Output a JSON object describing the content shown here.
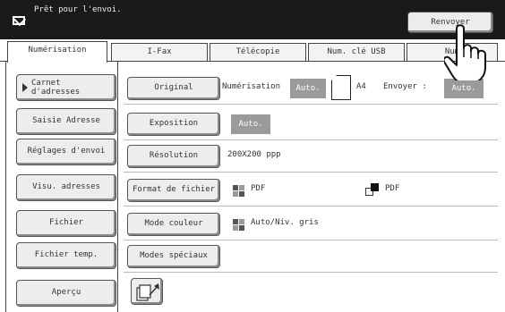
{
  "header": {
    "status_text": "Prêt pour l'envoi.",
    "resend_label": "Renvoyer"
  },
  "tabs": [
    {
      "label": "Numérisation",
      "active": true
    },
    {
      "label": "I-Fax"
    },
    {
      "label": "Télécopie"
    },
    {
      "label": "Num. clé USB"
    },
    {
      "label": "Num"
    }
  ],
  "sidebar": {
    "items": [
      {
        "label_line1": "Carnet",
        "label_line2": "d'adresses"
      },
      {
        "label": "Saisie Adresse"
      },
      {
        "label": "Réglages d'envoi"
      },
      {
        "label": "Visu. adresses"
      },
      {
        "label": "Fichier"
      },
      {
        "label": "Fichier temp."
      },
      {
        "label": "Aperçu"
      }
    ]
  },
  "settings": {
    "original": {
      "label": "Original",
      "scan_text": "Numérisation",
      "scan_value": "Auto.",
      "paper_size": "A4",
      "send_text": "Envoyer :",
      "send_value": "Auto."
    },
    "exposure": {
      "label": "Exposition",
      "value": "Auto."
    },
    "resolution": {
      "label": "Résolution",
      "value": "200X200 ppp"
    },
    "file_format": {
      "label": "Format de fichier",
      "value1": "PDF",
      "value2": "PDF"
    },
    "color_mode": {
      "label": "Mode couleur",
      "value": "Auto/Niv. gris"
    },
    "special_modes": {
      "label": "Modes spéciaux"
    }
  },
  "colors": {
    "topbar": "#1a1a1a",
    "auto_badge": "#9a9a9a"
  }
}
